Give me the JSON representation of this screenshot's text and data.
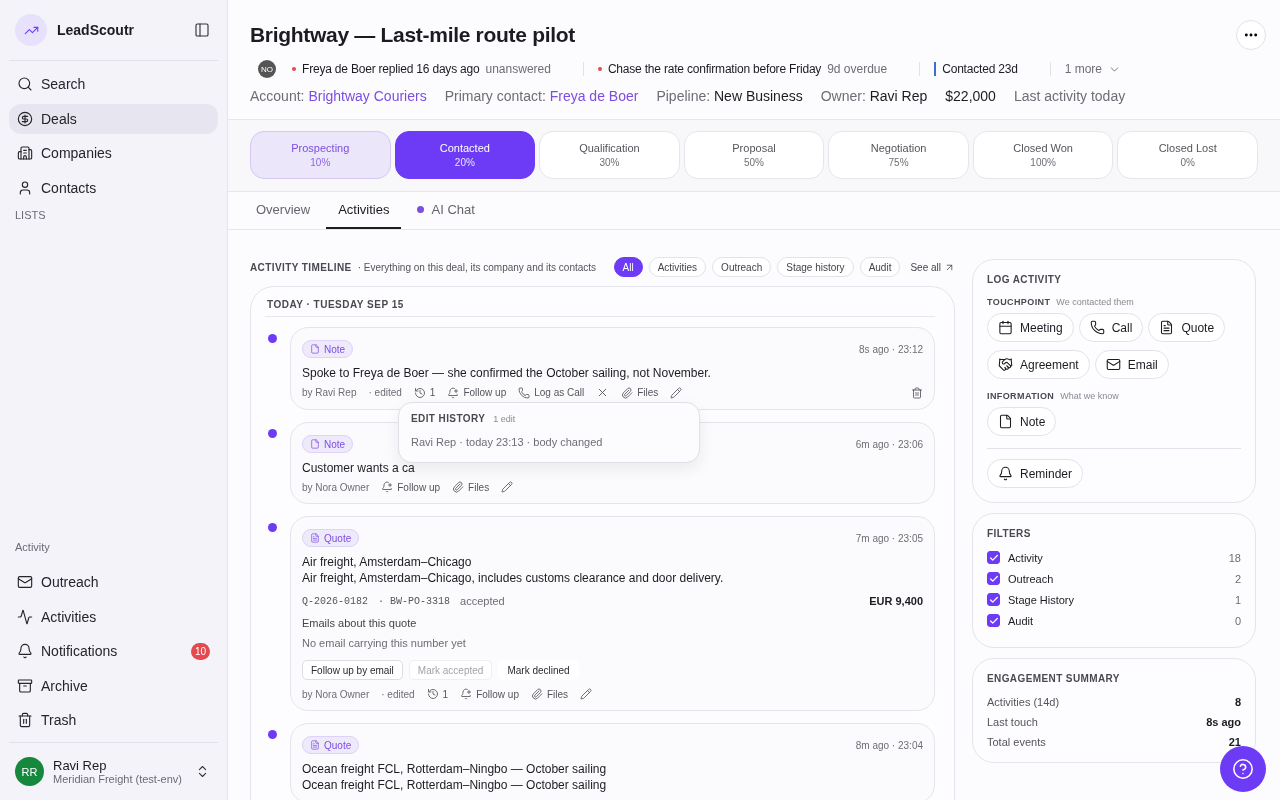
{
  "brand": {
    "name": "LeadScoutr"
  },
  "nav": [
    {
      "label": "Search",
      "selected": false
    },
    {
      "label": "Deals",
      "selected": true
    },
    {
      "label": "Companies",
      "selected": false
    },
    {
      "label": "Contacts",
      "selected": false
    }
  ],
  "lists_label": "LISTS",
  "activity_label": "Activity",
  "activity_nav": [
    {
      "label": "Outreach"
    },
    {
      "label": "Activities"
    },
    {
      "label": "Notifications",
      "badge": "10"
    },
    {
      "label": "Archive"
    },
    {
      "label": "Trash"
    }
  ],
  "user": {
    "initials": "RR",
    "name": "Ravi Rep",
    "org": "Meridian Freight (test-env)"
  },
  "deal": {
    "title": "Brightway — Last-mile route pilot",
    "avatar": "NO",
    "signals": [
      {
        "kind": "dot",
        "color": "#e5484d",
        "text": "Freya de Boer replied 16 days ago",
        "note": "unanswered"
      },
      {
        "kind": "dot",
        "color": "#e5484d",
        "text": "Chase the rate confirmation before Friday",
        "note": "9d overdue"
      },
      {
        "kind": "bar",
        "color": "#3b6fd1",
        "text": "Contacted 23d"
      }
    ],
    "more": "1 more",
    "facts": [
      {
        "kind": "link",
        "label": "Account:",
        "value": "Brightway Couriers"
      },
      {
        "kind": "link",
        "label": "Primary contact:",
        "value": "Freya de Boer"
      },
      {
        "kind": "value",
        "label": "Pipeline:",
        "value": "New Business"
      },
      {
        "kind": "value",
        "label": "Owner:",
        "value": "Ravi Rep"
      },
      {
        "kind": "amount",
        "value": "$22,000"
      },
      {
        "kind": "note",
        "value": "Last activity today"
      }
    ]
  },
  "stages": [
    {
      "name": "Prospecting",
      "percent": "10%",
      "completed": true,
      "selected": false
    },
    {
      "name": "Contacted",
      "percent": "20%",
      "completed": false,
      "selected": true
    },
    {
      "name": "Qualification",
      "percent": "30%",
      "completed": false,
      "selected": false
    },
    {
      "name": "Proposal",
      "percent": "50%",
      "completed": false,
      "selected": false
    },
    {
      "name": "Negotiation",
      "percent": "75%",
      "completed": false,
      "selected": false
    },
    {
      "name": "Closed Won",
      "percent": "100%",
      "completed": false,
      "selected": false
    },
    {
      "name": "Closed Lost",
      "percent": "0%",
      "completed": false,
      "selected": false
    }
  ],
  "tabs": [
    {
      "label": "Overview",
      "selected": false,
      "dot": false
    },
    {
      "label": "Activities",
      "selected": true,
      "dot": false
    },
    {
      "label": "AI Chat",
      "selected": false,
      "dot": true
    }
  ],
  "timeline": {
    "title": "ACTIVITY TIMELINE",
    "subtitle": "· Everything on this deal, its company and its contacts",
    "chips": [
      {
        "label": "All",
        "selected": true
      },
      {
        "label": "Activities",
        "selected": false
      },
      {
        "label": "Outreach",
        "selected": false
      },
      {
        "label": "Stage history",
        "selected": false
      },
      {
        "label": "Audit",
        "selected": false
      }
    ],
    "see_all": "See all",
    "date": "TODAY · TUESDAY SEP 15",
    "entries": [
      {
        "kind": "note",
        "type": "Note",
        "time": "8s ago · 23:12",
        "body": "Spoke to Freya de Boer — she confirmed the October sailing, not November.",
        "author": "by Ravi Rep",
        "edited": "· edited",
        "deletable": true,
        "actions": [
          {
            "kind": "history",
            "label": "1"
          },
          {
            "kind": "follow_up",
            "label": "Follow up"
          },
          {
            "kind": "log_call",
            "label": "Log as Call"
          },
          {
            "kind": "dismiss"
          },
          {
            "kind": "files",
            "label": "Files"
          },
          {
            "kind": "edit"
          }
        ],
        "popover": {
          "title": "EDIT HISTORY",
          "count": "1 edit",
          "line": "Ravi Rep · today 23:13 · body changed"
        }
      },
      {
        "kind": "note",
        "type": "Note",
        "time": "6m ago · 23:06",
        "body": "Customer wants a ca",
        "author": "by Nora Owner",
        "actions": [
          {
            "kind": "follow_up",
            "label": "Follow up"
          },
          {
            "kind": "files",
            "label": "Files"
          },
          {
            "kind": "edit"
          }
        ]
      },
      {
        "kind": "quote",
        "type": "Quote",
        "time": "7m ago · 23:05",
        "title": "Air freight, Amsterdam–Chicago",
        "body": "Air freight, Amsterdam–Chicago, includes customs clearance and door delivery.",
        "number": "Q-2026-0182",
        "po": "· BW-PO-3318",
        "status": "accepted",
        "amount": "EUR 9,400",
        "emails_title": "Emails about this quote",
        "emails_empty": "No email carrying this number yet",
        "buttons": [
          {
            "label": "Follow up by email",
            "kind": "outlined",
            "disabled": false
          },
          {
            "label": "Mark accepted",
            "kind": "outlined",
            "disabled": true
          },
          {
            "label": "Mark declined",
            "kind": "plain",
            "disabled": false
          }
        ],
        "author": "by Nora Owner",
        "edited": "· edited",
        "actions": [
          {
            "kind": "history",
            "label": "1"
          },
          {
            "kind": "follow_up",
            "label": "Follow up"
          },
          {
            "kind": "files",
            "label": "Files"
          },
          {
            "kind": "edit"
          }
        ]
      },
      {
        "kind": "quote",
        "type": "Quote",
        "time": "8m ago · 23:04",
        "title": "Ocean freight FCL, Rotterdam–Ningbo — October sailing",
        "body": "Ocean freight FCL, Rotterdam–Ningbo — October sailing"
      }
    ]
  },
  "log_activity": {
    "title": "LOG ACTIVITY",
    "groups": [
      {
        "label": "TOUCHPOINT",
        "hint": "We contacted them",
        "buttons": [
          "Meeting",
          "Call",
          "Quote",
          "Agreement",
          "Email"
        ]
      },
      {
        "label": "INFORMATION",
        "hint": "What we know",
        "buttons": [
          "Note"
        ]
      }
    ],
    "reminder": "Reminder"
  },
  "filters": {
    "title": "FILTERS",
    "items": [
      {
        "label": "Activity",
        "count": "18",
        "checked": true
      },
      {
        "label": "Outreach",
        "count": "2",
        "checked": true
      },
      {
        "label": "Stage History",
        "count": "1",
        "checked": true
      },
      {
        "label": "Audit",
        "count": "0",
        "checked": true
      }
    ]
  },
  "summary": {
    "title": "ENGAGEMENT SUMMARY",
    "rows": [
      {
        "label": "Activities (14d)",
        "value": "8"
      },
      {
        "label": "Last touch",
        "value": "8s ago"
      },
      {
        "label": "Total events",
        "value": "21"
      }
    ]
  }
}
